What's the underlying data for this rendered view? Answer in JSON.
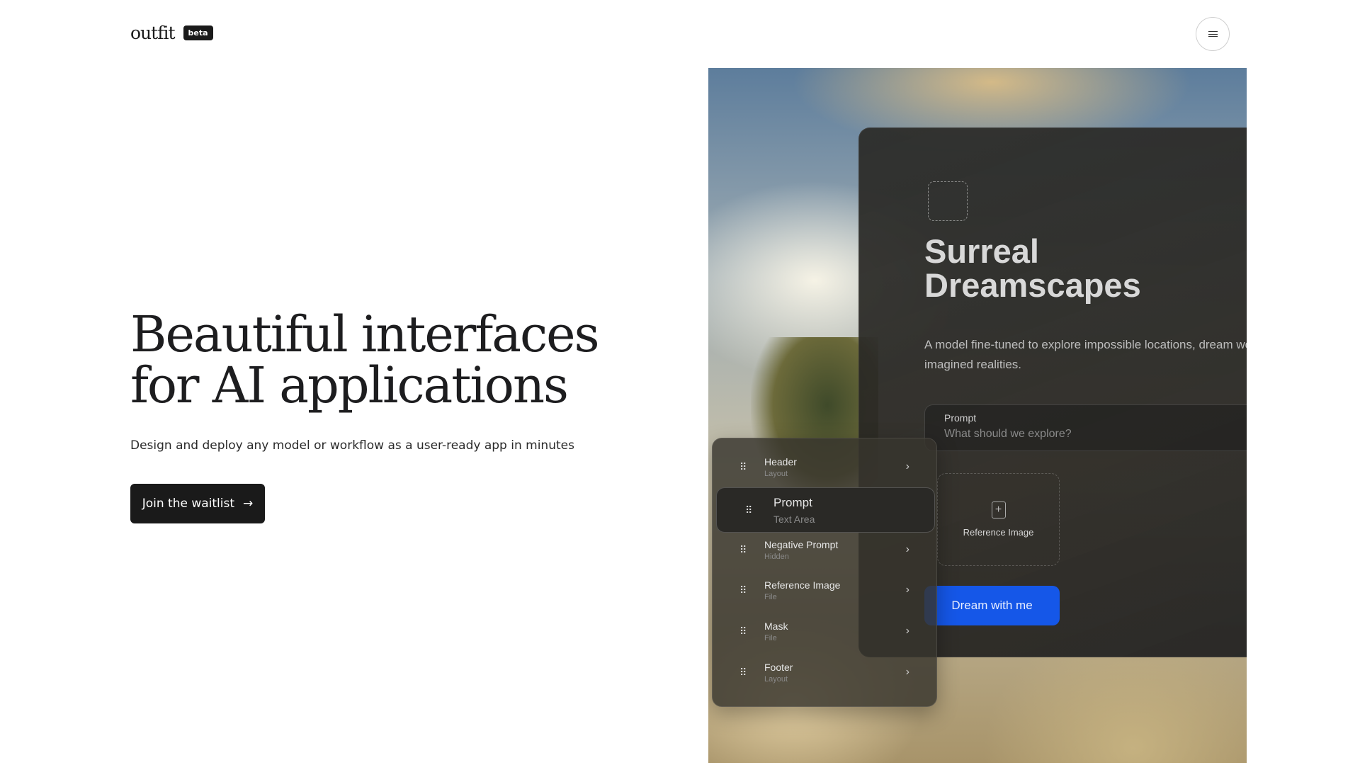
{
  "brand": {
    "name": "outfit",
    "badge": "beta"
  },
  "nav": {
    "menu_icon": "hamburger-icon"
  },
  "hero": {
    "title_line1": "Beautiful interfaces",
    "title_line2": "for AI applications",
    "subtitle": "Design and deploy any model or workflow as a user-ready app in minutes",
    "cta": "Join the waitlist",
    "cta_icon": "→"
  },
  "preview": {
    "title_line1": "Surreal",
    "title_line2": "Dreamscapes",
    "description": "A model fine-tuned to explore impossible locations, dream worlds, and imagined realities.",
    "prompt_label": "Prompt",
    "prompt_placeholder": "What should we explore?",
    "reference_label": "Reference Image",
    "reference_icon": "+",
    "button": "Dream with me",
    "button_color": "#1557e8"
  },
  "layers": [
    {
      "title": "Header",
      "type": "Layout"
    },
    {
      "title": "Prompt",
      "type": "Text Area"
    },
    {
      "title": "Negative Prompt",
      "type": "Hidden"
    },
    {
      "title": "Reference Image",
      "type": "File"
    },
    {
      "title": "Mask",
      "type": "File"
    },
    {
      "title": "Footer",
      "type": "Layout"
    }
  ],
  "icons": {
    "grip": "⠿",
    "chevron": "›"
  }
}
